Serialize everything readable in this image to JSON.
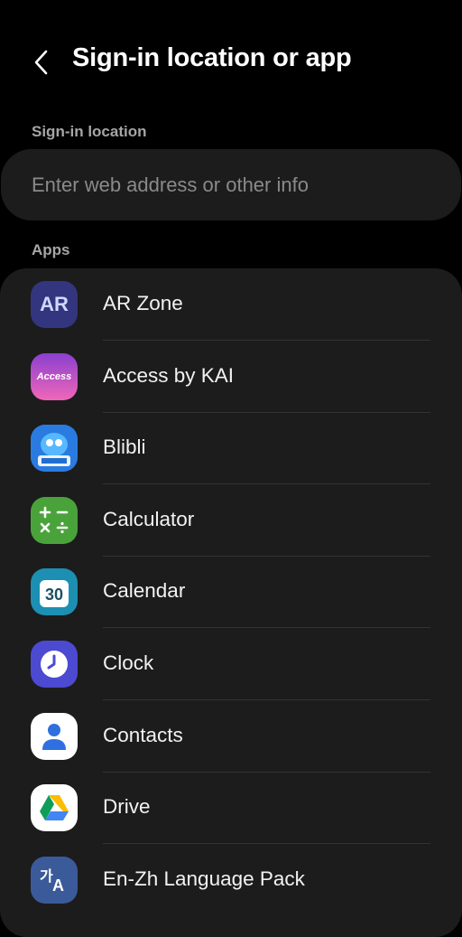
{
  "header": {
    "title": "Sign-in location or app",
    "back_icon": "back-arrow-icon"
  },
  "sign_in_location": {
    "label": "Sign-in location",
    "placeholder": "Enter web address or other info",
    "value": ""
  },
  "apps": {
    "label": "Apps",
    "items": [
      {
        "name": "AR Zone",
        "icon": "ar-zone-icon",
        "color": "#3a3d8f"
      },
      {
        "name": "Access by KAI",
        "icon": "access-by-kai-icon",
        "color": "#e84fae"
      },
      {
        "name": "Blibli",
        "icon": "blibli-icon",
        "color": "#1f6fd1"
      },
      {
        "name": "Calculator",
        "icon": "calculator-icon",
        "color": "#4aa33a"
      },
      {
        "name": "Calendar",
        "icon": "calendar-icon",
        "color": "#1c8fb3"
      },
      {
        "name": "Clock",
        "icon": "clock-icon",
        "color": "#4b4ad1"
      },
      {
        "name": "Contacts",
        "icon": "contacts-icon",
        "color": "#ffffff"
      },
      {
        "name": "Drive",
        "icon": "google-drive-icon",
        "color": "#ffffff"
      },
      {
        "name": "En-Zh Language Pack",
        "icon": "language-pack-icon",
        "color": "#3b5a9a"
      }
    ]
  },
  "icon_text": {
    "ar": "AR",
    "access": "Access",
    "calendar_day": "30",
    "lang_top": "가",
    "lang_bottom": "A"
  }
}
